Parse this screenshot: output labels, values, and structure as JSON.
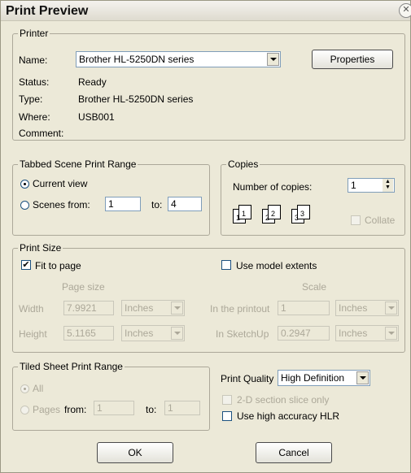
{
  "window": {
    "title": "Print Preview"
  },
  "printer": {
    "legend": "Printer",
    "name_label": "Name:",
    "name_value": "Brother HL-5250DN series",
    "properties_button": "Properties",
    "status_label": "Status:",
    "status_value": "Ready",
    "type_label": "Type:",
    "type_value": "Brother HL-5250DN series",
    "where_label": "Where:",
    "where_value": "USB001",
    "comment_label": "Comment:"
  },
  "scene_range": {
    "legend": "Tabbed Scene Print Range",
    "current_view": "Current view",
    "scenes_from": "Scenes from:",
    "from_value": "1",
    "to_label": "to:",
    "to_value": "4"
  },
  "copies": {
    "legend": "Copies",
    "number_label": "Number of copies:",
    "number_value": "1",
    "collate": "Collate"
  },
  "print_size": {
    "legend": "Print Size",
    "fit_to_page": "Fit to page",
    "use_model_extents": "Use model extents",
    "page_size_label": "Page size",
    "scale_label": "Scale",
    "width_label": "Width",
    "width_value": "7.9921",
    "width_unit": "Inches",
    "height_label": "Height",
    "height_value": "5.1165",
    "height_unit": "Inches",
    "in_printout_label": "In the printout",
    "in_printout_value": "1",
    "in_printout_unit": "Inches",
    "in_sketchup_label": "In SketchUp",
    "in_sketchup_value": "0.2947",
    "in_sketchup_unit": "Inches"
  },
  "tiled": {
    "legend": "Tiled Sheet Print Range",
    "all": "All",
    "pages": "Pages",
    "from_label": "from:",
    "from_value": "1",
    "to_label": "to:",
    "to_value": "1"
  },
  "quality": {
    "label": "Print Quality",
    "value": "High Definition",
    "section_slice": "2-D section slice only",
    "high_accuracy": "Use high accuracy HLR"
  },
  "buttons": {
    "ok": "OK",
    "cancel": "Cancel"
  }
}
